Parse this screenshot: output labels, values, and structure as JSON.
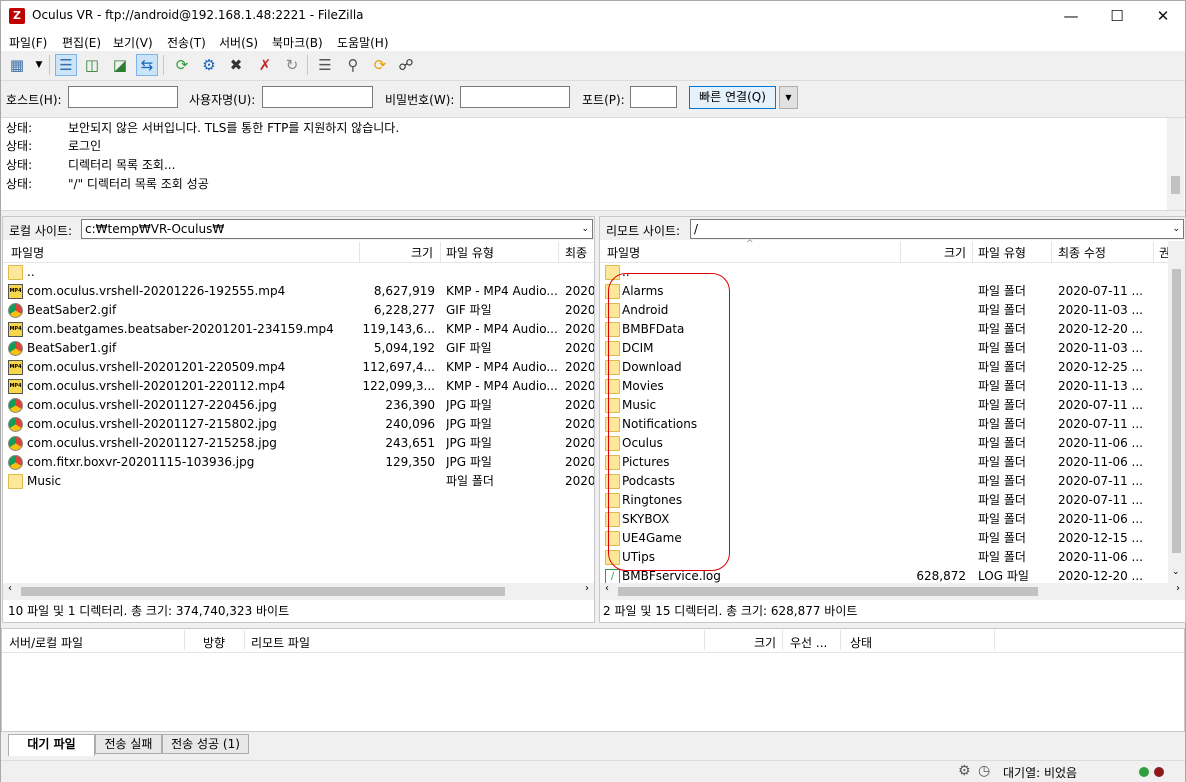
{
  "window": {
    "title": "Oculus VR - ftp://android@192.168.1.48:2221 - FileZilla",
    "app_icon_glyph": "Z"
  },
  "menu": [
    "파일(F)",
    "편집(E)",
    "보기(V)",
    "전송(T)",
    "서버(S)",
    "북마크(B)",
    "도움말(H)"
  ],
  "quickconnect": {
    "host_label": "호스트(H):",
    "user_label": "사용자명(U):",
    "pass_label": "비밀번호(W):",
    "port_label": "포트(P):",
    "host_value": "",
    "user_value": "",
    "pass_value": "",
    "port_value": "",
    "connect_label": "빠른 연결(Q)"
  },
  "log": [
    {
      "k": "상태:",
      "v": "보안되지 않은 서버입니다. TLS를 통한 FTP를 지원하지 않습니다."
    },
    {
      "k": "상태:",
      "v": "로그인"
    },
    {
      "k": "상태:",
      "v": "디렉터리 목록 조회..."
    },
    {
      "k": "상태:",
      "v": "\"/\" 디렉터리 목록 조회 성공"
    }
  ],
  "local": {
    "site_label": "로컬 사이트:",
    "path": "c:₩temp₩VR-Oculus₩",
    "headers": {
      "name": "파일명",
      "size": "크기",
      "type": "파일 유형",
      "mod": "최종"
    },
    "files": [
      {
        "icon": "folder",
        "name": "..",
        "size": "",
        "type": "",
        "mod": ""
      },
      {
        "icon": "mp4",
        "name": "com.oculus.vrshell-20201226-192555.mp4",
        "size": "8,627,919",
        "type": "KMP - MP4 Audio...",
        "mod": "2020"
      },
      {
        "icon": "gif",
        "name": "BeatSaber2.gif",
        "size": "6,228,277",
        "type": "GIF 파일",
        "mod": "2020"
      },
      {
        "icon": "mp4",
        "name": "com.beatgames.beatsaber-20201201-234159.mp4",
        "size": "119,143,6...",
        "type": "KMP - MP4 Audio...",
        "mod": "2020"
      },
      {
        "icon": "gif",
        "name": "BeatSaber1.gif",
        "size": "5,094,192",
        "type": "GIF 파일",
        "mod": "2020"
      },
      {
        "icon": "mp4",
        "name": "com.oculus.vrshell-20201201-220509.mp4",
        "size": "112,697,4...",
        "type": "KMP - MP4 Audio...",
        "mod": "2020"
      },
      {
        "icon": "mp4",
        "name": "com.oculus.vrshell-20201201-220112.mp4",
        "size": "122,099,3...",
        "type": "KMP - MP4 Audio...",
        "mod": "2020"
      },
      {
        "icon": "gif",
        "name": "com.oculus.vrshell-20201127-220456.jpg",
        "size": "236,390",
        "type": "JPG 파일",
        "mod": "2020"
      },
      {
        "icon": "gif",
        "name": "com.oculus.vrshell-20201127-215802.jpg",
        "size": "240,096",
        "type": "JPG 파일",
        "mod": "2020"
      },
      {
        "icon": "gif",
        "name": "com.oculus.vrshell-20201127-215258.jpg",
        "size": "243,651",
        "type": "JPG 파일",
        "mod": "2020"
      },
      {
        "icon": "gif",
        "name": "com.fitxr.boxvr-20201115-103936.jpg",
        "size": "129,350",
        "type": "JPG 파일",
        "mod": "2020"
      },
      {
        "icon": "folder",
        "name": "Music",
        "size": "",
        "type": "파일 폴더",
        "mod": "2020"
      }
    ],
    "status": "10 파일 및 1 디렉터리. 총 크기: 374,740,323 바이트"
  },
  "remote": {
    "site_label": "리모트 사이트:",
    "path": "/",
    "headers": {
      "name": "파일명",
      "size": "크기",
      "type": "파일 유형",
      "mod": "최종 수정",
      "perm": "권"
    },
    "files": [
      {
        "icon": "folder",
        "name": "..",
        "size": "",
        "type": "",
        "mod": ""
      },
      {
        "icon": "folder",
        "name": "Alarms",
        "size": "",
        "type": "파일 폴더",
        "mod": "2020-07-11 ..."
      },
      {
        "icon": "folder",
        "name": "Android",
        "size": "",
        "type": "파일 폴더",
        "mod": "2020-11-03 ..."
      },
      {
        "icon": "folder",
        "name": "BMBFData",
        "size": "",
        "type": "파일 폴더",
        "mod": "2020-12-20 ..."
      },
      {
        "icon": "folder",
        "name": "DCIM",
        "size": "",
        "type": "파일 폴더",
        "mod": "2020-11-03 ..."
      },
      {
        "icon": "folder",
        "name": "Download",
        "size": "",
        "type": "파일 폴더",
        "mod": "2020-12-25 ..."
      },
      {
        "icon": "folder",
        "name": "Movies",
        "size": "",
        "type": "파일 폴더",
        "mod": "2020-11-13 ..."
      },
      {
        "icon": "folder",
        "name": "Music",
        "size": "",
        "type": "파일 폴더",
        "mod": "2020-07-11 ..."
      },
      {
        "icon": "folder",
        "name": "Notifications",
        "size": "",
        "type": "파일 폴더",
        "mod": "2020-07-11 ..."
      },
      {
        "icon": "folder",
        "name": "Oculus",
        "size": "",
        "type": "파일 폴더",
        "mod": "2020-11-06 ..."
      },
      {
        "icon": "folder",
        "name": "Pictures",
        "size": "",
        "type": "파일 폴더",
        "mod": "2020-11-06 ..."
      },
      {
        "icon": "folder",
        "name": "Podcasts",
        "size": "",
        "type": "파일 폴더",
        "mod": "2020-07-11 ..."
      },
      {
        "icon": "folder",
        "name": "Ringtones",
        "size": "",
        "type": "파일 폴더",
        "mod": "2020-07-11 ..."
      },
      {
        "icon": "folder",
        "name": "SKYBOX",
        "size": "",
        "type": "파일 폴더",
        "mod": "2020-11-06 ..."
      },
      {
        "icon": "folder",
        "name": "UE4Game",
        "size": "",
        "type": "파일 폴더",
        "mod": "2020-12-15 ..."
      },
      {
        "icon": "folder",
        "name": "UTips",
        "size": "",
        "type": "파일 폴더",
        "mod": "2020-11-06 ..."
      },
      {
        "icon": "log",
        "name": "BMBFservice.log",
        "size": "628,872",
        "type": "LOG 파일",
        "mod": "2020-12-20 ..."
      }
    ],
    "status": "2 파일 및 15 디렉터리. 총 크기: 628,877 바이트"
  },
  "queue": {
    "headers": {
      "server_local": "서버/로컬 파일",
      "direction": "방향",
      "remote_file": "리모트 파일",
      "size": "크기",
      "priority": "우선 ...",
      "status": "상태"
    }
  },
  "queue_tabs": [
    "대기 파일",
    "전송 실패",
    "전송 성공 (1)"
  ],
  "statusbar": {
    "queue": "대기열: 비었음"
  },
  "colors": {
    "highlight": "#e00000",
    "accent": "#0078d7"
  }
}
